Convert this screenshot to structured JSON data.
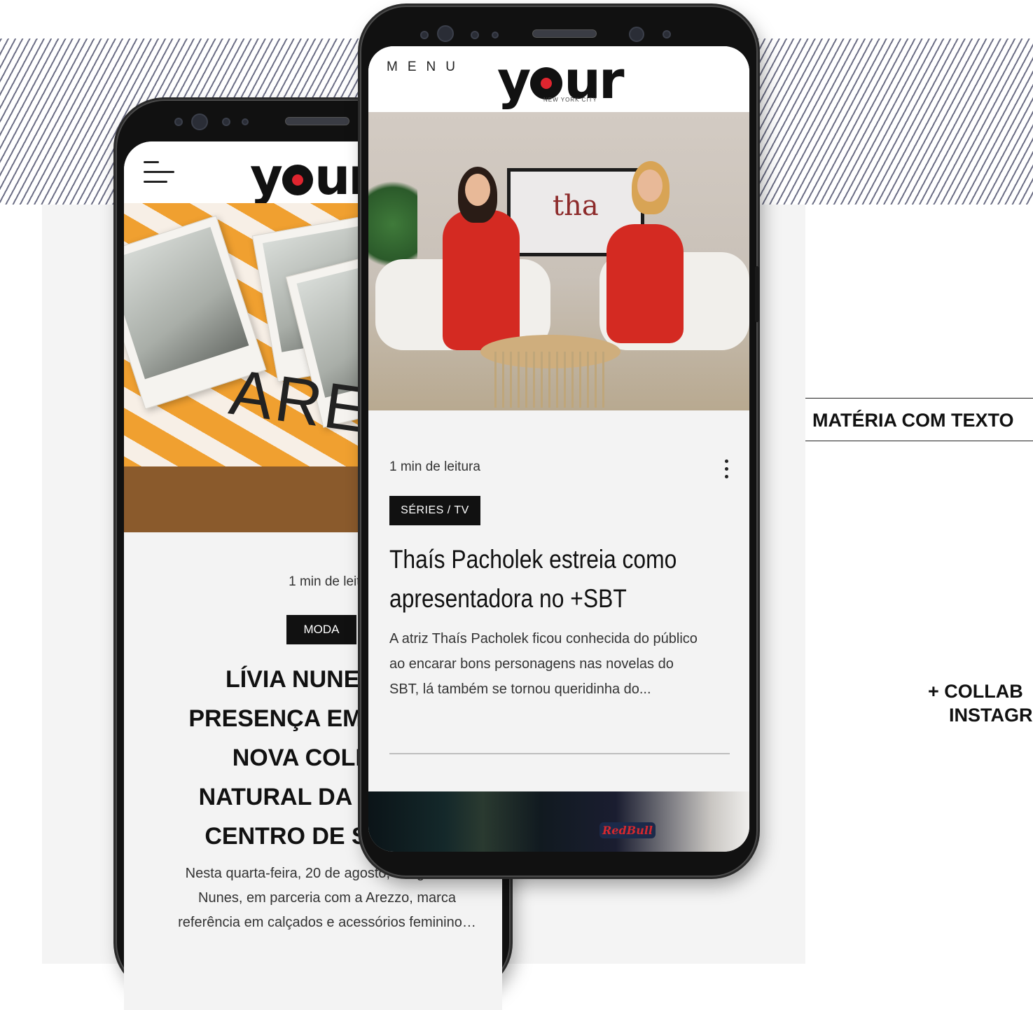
{
  "right_labels": {
    "section_label": "MATÉRIA COM TEXTO",
    "collab_line1": "+ COLLAB",
    "collab_line2": "INSTAGRAM"
  },
  "phone_back": {
    "logo": "your",
    "read_time": "1 min de leitura",
    "category": "MODA",
    "image_text": "AREZZO",
    "title_lines": [
      "LÍVIA NUNES MARCA",
      "PRESENÇA EM EVENTO DA",
      "NOVA COLEÇÃO DE",
      "NATURAL DA AREZZO NO",
      "CENTRO DE SÃO PAULO"
    ],
    "excerpt_lines": [
      "Nesta quarta-feira, 20 de agosto, a it girl Lívia",
      "Nunes, em parceria com a Arezzo, marca",
      "referência em calçados e acessórios feminino…"
    ]
  },
  "phone_front": {
    "menu_label": "MENU",
    "logo": "your",
    "logo_sub": "NEW YORK CITY",
    "tv_logo": "tha",
    "read_time": "1 min de leitura",
    "category": "SÉRIES / TV",
    "title_lines": [
      "Thaís Pacholek estreia como",
      "apresentadora no +SBT"
    ],
    "excerpt_lines": [
      "A atriz Thaís Pacholek ficou conhecida do público",
      "ao encarar bons personagens nas novelas do",
      "SBT, lá também se tornou queridinha do..."
    ],
    "next_image_text": "RedBull"
  },
  "colors": {
    "logo_dot": "#e0252f",
    "hatch": "#6d6f86",
    "tag_bg": "#111111"
  }
}
